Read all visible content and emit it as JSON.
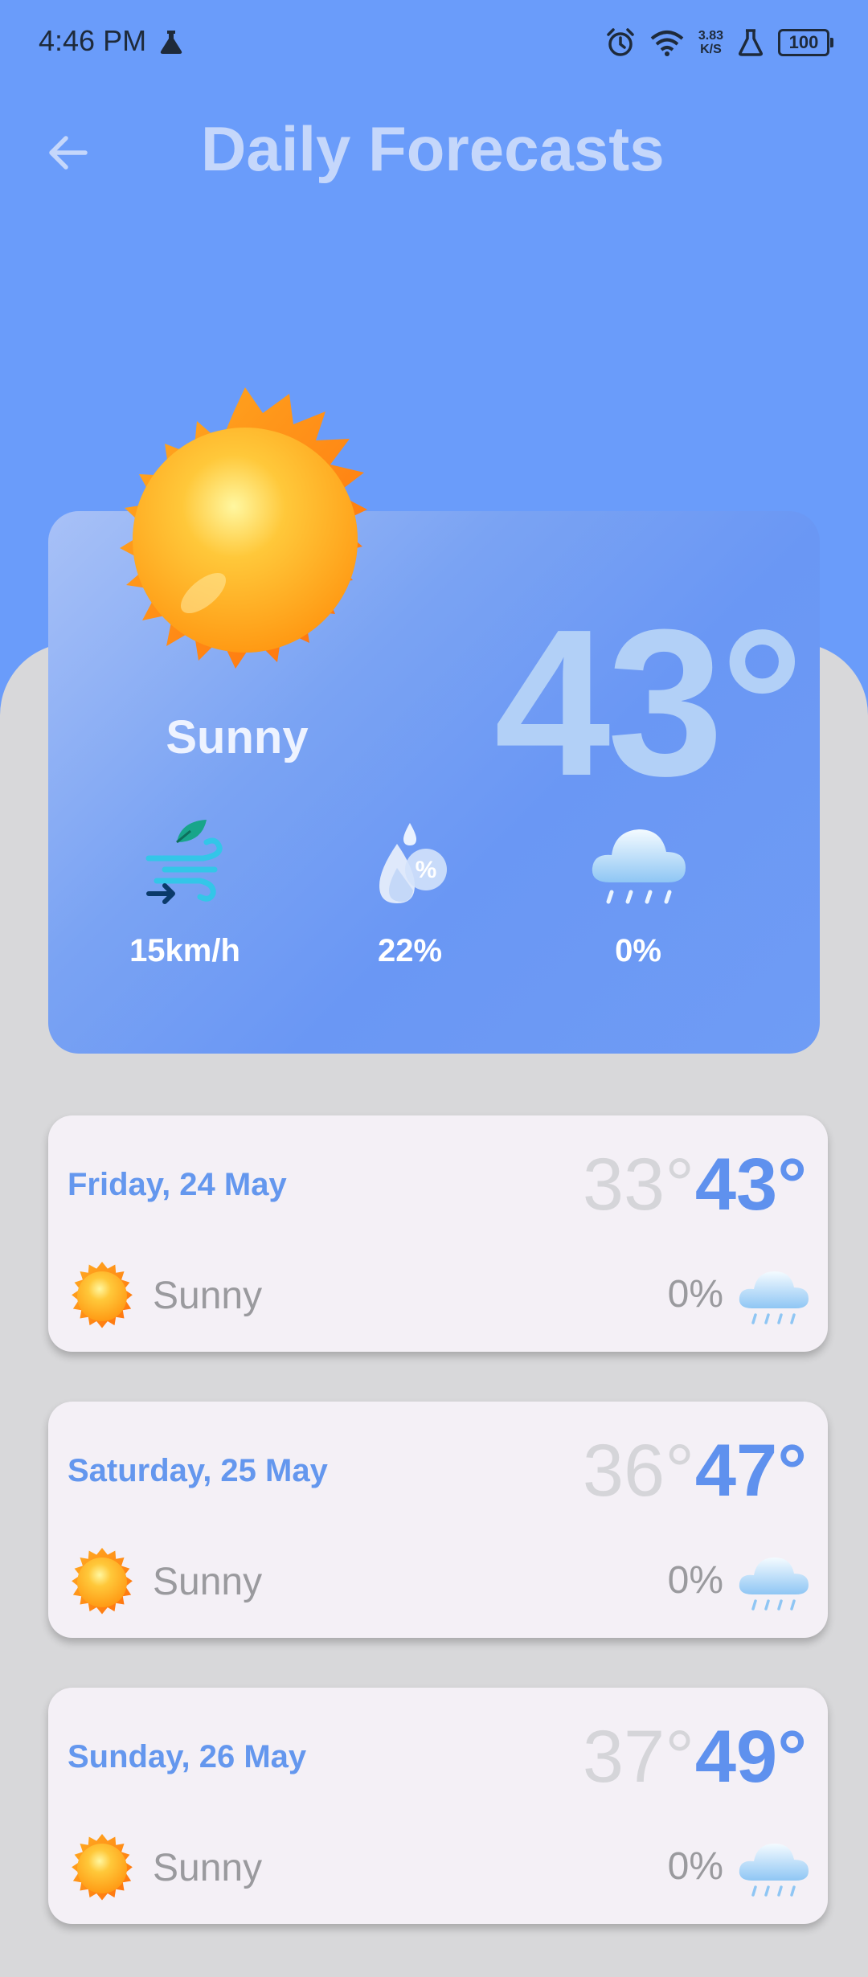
{
  "status": {
    "time": "4:46 PM",
    "speed_top": "3.83",
    "speed_bottom": "K/S",
    "battery": "100"
  },
  "header": {
    "title": "Daily Forecasts"
  },
  "hero": {
    "temp": "43°",
    "condition": "Sunny",
    "wind": "15km/h",
    "humidity": "22%",
    "precip": "0%"
  },
  "forecasts": [
    {
      "date": "Friday, 24 May",
      "low": "33°",
      "high": "43°",
      "condition": "Sunny",
      "rain": "0%"
    },
    {
      "date": "Saturday, 25 May",
      "low": "36°",
      "high": "47°",
      "condition": "Sunny",
      "rain": "0%"
    },
    {
      "date": "Sunday, 26 May",
      "low": "37°",
      "high": "49°",
      "condition": "Sunny",
      "rain": "0%"
    }
  ],
  "icons": [
    "arrow-left-icon",
    "sun-icon",
    "wind-icon",
    "humidity-icon",
    "rain-cloud-icon",
    "alarm-icon",
    "wifi-icon",
    "flask-icon",
    "battery-icon"
  ]
}
